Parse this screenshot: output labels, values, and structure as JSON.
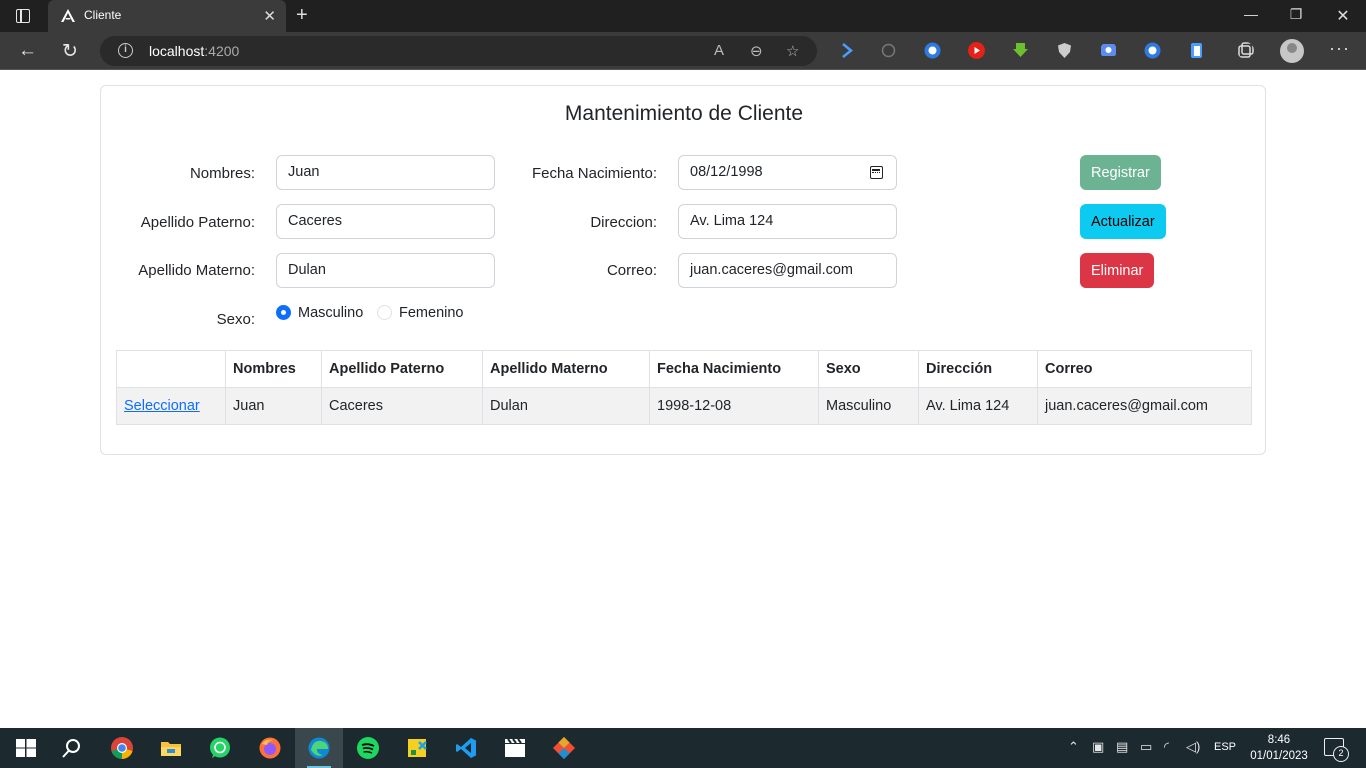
{
  "browser": {
    "tab_title": "Cliente",
    "url_host": "localhost",
    "url_port": ":4200",
    "new_tab_symbol": "+"
  },
  "form": {
    "title": "Mantenimiento de Cliente",
    "labels": {
      "nombres": "Nombres:",
      "apellido_paterno": "Apellido Paterno:",
      "apellido_materno": "Apellido Materno:",
      "sexo": "Sexo:",
      "fecha_nacimiento": "Fecha Nacimiento:",
      "direccion": "Direccion:",
      "correo": "Correo:"
    },
    "values": {
      "nombres": "Juan",
      "apellido_paterno": "Caceres",
      "apellido_materno": "Dulan",
      "fecha_nacimiento": "08/12/1998",
      "direccion": "Av. Lima 124",
      "correo": "juan.caceres@gmail.com"
    },
    "sexo_options": [
      {
        "label": "Masculino",
        "checked": true
      },
      {
        "label": "Femenino",
        "checked": false
      }
    ],
    "buttons": {
      "registrar": "Registrar",
      "actualizar": "Actualizar",
      "eliminar": "Eliminar"
    },
    "colors": {
      "registrar": "#6cb393",
      "actualizar": "#0dcaf0",
      "eliminar": "#dc3545",
      "link": "#0d6efd"
    }
  },
  "table": {
    "headers": [
      "",
      "Nombres",
      "Apellido Paterno",
      "Apellido Materno",
      "Fecha Nacimiento",
      "Sexo",
      "Dirección",
      "Correo"
    ],
    "rows": [
      {
        "action": "Seleccionar",
        "cells": [
          "Juan",
          "Caceres",
          "Dulan",
          "1998-12-08",
          "Masculino",
          "Av. Lima 124",
          "juan.caceres@gmail.com"
        ]
      }
    ]
  },
  "taskbar": {
    "time": "8:46",
    "date": "01/01/2023",
    "language": "ESP",
    "notification_count": "2",
    "apps": [
      "start-icon",
      "search-icon",
      "chrome-icon",
      "file-explorer-icon",
      "whatsapp-icon",
      "firefox-icon",
      "edge-icon",
      "spotify-icon",
      "sticky-app-icon",
      "vscode-icon",
      "clapper-icon",
      "git-icon"
    ]
  }
}
